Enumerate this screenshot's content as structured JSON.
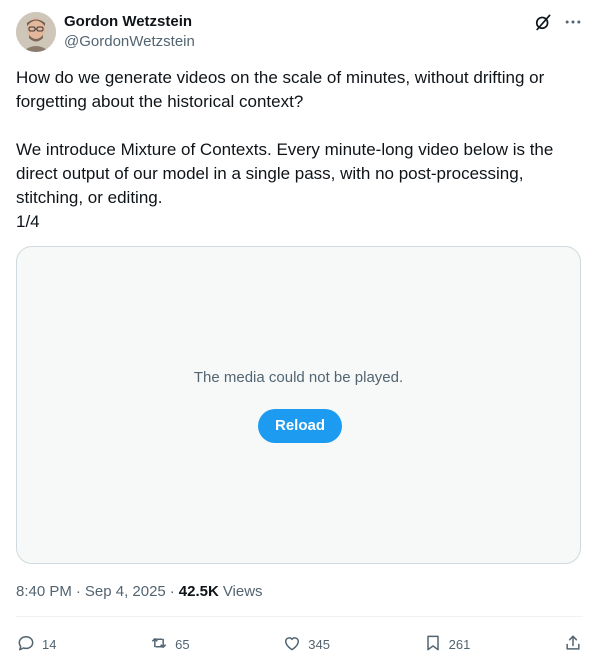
{
  "author": {
    "name": "Gordon Wetzstein",
    "handle": "@GordonWetzstein"
  },
  "tweet": {
    "text": "How do we generate videos on the scale of minutes, without drifting or\nforgetting about the historical context?\n\nWe introduce Mixture of Contexts. Every minute-long video below is the\ndirect output of our model in a single pass, with no post-processing,\nstitching, or editing.\n1/4"
  },
  "media": {
    "message": "The media could not be played.",
    "reload_label": "Reload"
  },
  "meta": {
    "time": "8:40 PM",
    "date": "Sep 4, 2025",
    "views_count": "42.5K",
    "views_label": "Views",
    "separator": "·"
  },
  "actions": {
    "replies": "14",
    "reposts": "65",
    "likes": "345",
    "bookmarks": "261"
  },
  "colors": {
    "accent": "#1d9bf0",
    "text_secondary": "#536471",
    "border": "#cfd9de"
  },
  "icons": [
    "grok-icon",
    "more-icon",
    "reply-icon",
    "repost-icon",
    "like-icon",
    "bookmark-icon",
    "share-icon"
  ]
}
